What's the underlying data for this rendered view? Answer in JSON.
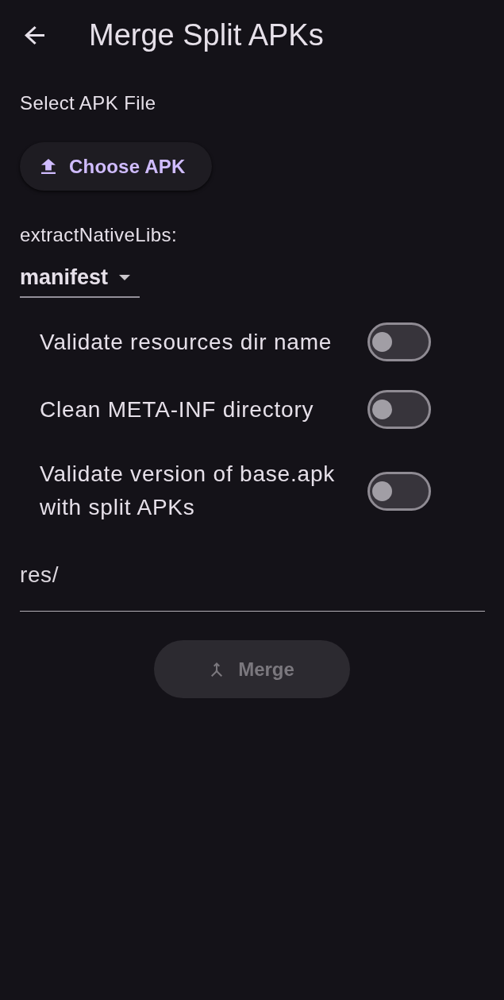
{
  "app_bar": {
    "title": "Merge Split APKs"
  },
  "file_picker": {
    "label": "Select APK File",
    "button": "Choose APK"
  },
  "extract_native_libs": {
    "label": "extractNativeLibs:",
    "value": "manifest"
  },
  "options": [
    {
      "label": "Validate resources dir name",
      "on": false
    },
    {
      "label": "Clean META-INF directory",
      "on": false
    },
    {
      "label": "Validate version of base.apk with split APKs",
      "on": false
    }
  ],
  "path_field": {
    "value": "res/"
  },
  "merge_button": {
    "label": "Merge",
    "disabled": true
  }
}
